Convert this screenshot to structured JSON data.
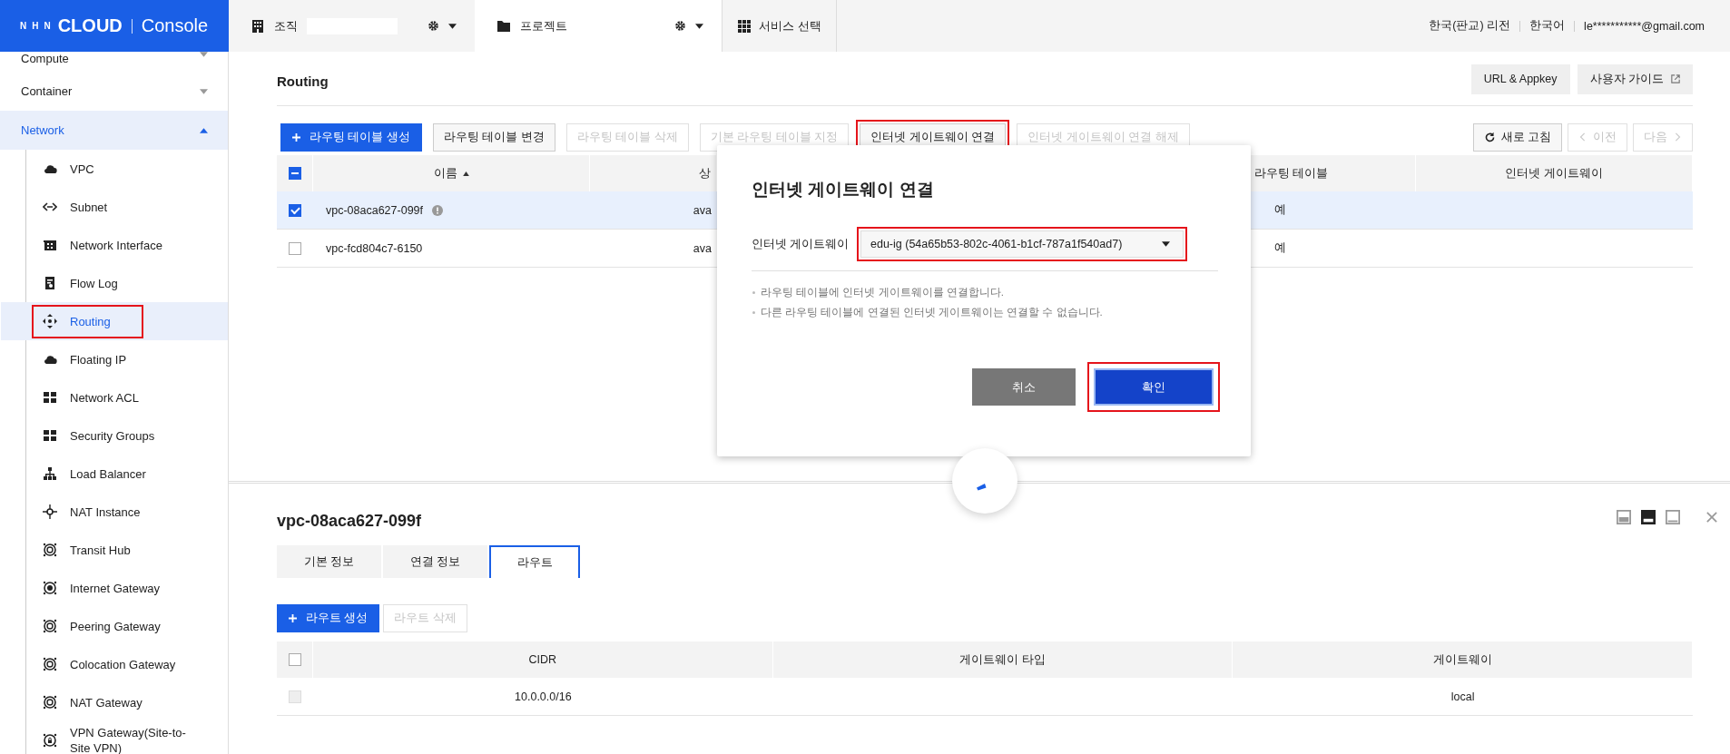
{
  "header": {
    "logo_mark": "NHN",
    "logo_brand": "CLOUD",
    "logo_product": "Console",
    "org_label": "조직",
    "project_label": "프로젝트",
    "service_select": "서비스 선택",
    "region": "한국(판교) 리전",
    "language": "한국어",
    "account": "le***********@gmail.com"
  },
  "sidebar": {
    "groups": [
      {
        "label": "Compute",
        "expanded": false,
        "selected": false
      },
      {
        "label": "Container",
        "expanded": false,
        "selected": false
      },
      {
        "label": "Network",
        "expanded": true,
        "selected": true,
        "children": [
          {
            "label": "VPC",
            "selected": false,
            "highlighted": false
          },
          {
            "label": "Subnet",
            "selected": false,
            "highlighted": false
          },
          {
            "label": "Network Interface",
            "selected": false,
            "highlighted": false
          },
          {
            "label": "Flow Log",
            "selected": false,
            "highlighted": false
          },
          {
            "label": "Routing",
            "selected": true,
            "highlighted": true
          },
          {
            "label": "Floating IP",
            "selected": false,
            "highlighted": false
          },
          {
            "label": "Network ACL",
            "selected": false,
            "highlighted": false
          },
          {
            "label": "Security Groups",
            "selected": false,
            "highlighted": false
          },
          {
            "label": "Load Balancer",
            "selected": false,
            "highlighted": false
          },
          {
            "label": "NAT Instance",
            "selected": false,
            "highlighted": false
          },
          {
            "label": "Transit Hub",
            "selected": false,
            "highlighted": false
          },
          {
            "label": "Internet Gateway",
            "selected": false,
            "highlighted": false
          },
          {
            "label": "Peering Gateway",
            "selected": false,
            "highlighted": false
          },
          {
            "label": "Colocation Gateway",
            "selected": false,
            "highlighted": false
          },
          {
            "label": "NAT Gateway",
            "selected": false,
            "highlighted": false
          },
          {
            "label": "VPN Gateway(Site-to-Site VPN)",
            "selected": false,
            "highlighted": false
          }
        ]
      }
    ]
  },
  "page": {
    "title": "Routing",
    "top_buttons": [
      {
        "label": "URL & Appkey",
        "external": false
      },
      {
        "label": "사용자 가이드",
        "external": true
      }
    ],
    "toolbar": [
      {
        "label": "라우팅 테이블 생성",
        "kind": "primary",
        "disabled": false,
        "highlighted": false
      },
      {
        "label": "라우팅 테이블 변경",
        "kind": "default",
        "disabled": false,
        "highlighted": false
      },
      {
        "label": "라우팅 테이블 삭제",
        "kind": "default",
        "disabled": true,
        "highlighted": false
      },
      {
        "label": "기본 라우팅 테이블 지정",
        "kind": "default",
        "disabled": true,
        "highlighted": false
      },
      {
        "label": "인터넷 게이트웨이 연결",
        "kind": "default",
        "disabled": false,
        "highlighted": true
      },
      {
        "label": "인터넷 게이트웨이 연결 해제",
        "kind": "default",
        "disabled": true,
        "highlighted": false
      }
    ],
    "nav_buttons": [
      {
        "label": "새로 고침",
        "kind": "refresh",
        "disabled": false
      },
      {
        "label": "이전",
        "kind": "prev",
        "disabled": true
      },
      {
        "label": "다음",
        "kind": "next",
        "disabled": true
      }
    ],
    "table": {
      "all_checkbox": {
        "indeterminate": true
      },
      "columns": [
        {
          "label": "이름",
          "sorted": true
        },
        {
          "label": "상",
          "sorted": false
        },
        {
          "label": "라우팅 테이블",
          "sorted": false
        },
        {
          "label": "인터넷 게이트웨이",
          "sorted": false
        }
      ],
      "rows": [
        {
          "selected": true,
          "name": "vpc-08aca627-099f",
          "warning": true,
          "status": "ava",
          "default_table": "예"
        },
        {
          "selected": false,
          "name": "vpc-fcd804c7-6150",
          "warning": false,
          "status": "ava",
          "default_table": "예"
        }
      ]
    }
  },
  "modal": {
    "title": "인터넷 게이트웨이 연결",
    "field_label": "인터넷 게이트웨이",
    "select_value": "edu-ig (54a65b53-802c-4061-b1cf-787a1f540ad7)",
    "select_highlighted": true,
    "notes": [
      "라우팅 테이블에 인터넷 게이트웨이를 연결합니다.",
      "다른 라우팅 테이블에 연결된 인터넷 게이트웨이는 연결할 수 없습니다."
    ],
    "buttons": [
      {
        "label": "취소",
        "kind": "cancel",
        "highlighted": false
      },
      {
        "label": "확인",
        "kind": "confirm",
        "highlighted": true
      }
    ]
  },
  "detail": {
    "title": "vpc-08aca627-099f",
    "layout_modes": [
      {
        "selected": false
      },
      {
        "selected": true
      },
      {
        "selected": false
      }
    ],
    "tabs": [
      {
        "label": "기본 정보",
        "selected": false
      },
      {
        "label": "연결 정보",
        "selected": false
      },
      {
        "label": "라우트",
        "selected": true
      }
    ],
    "buttons": [
      {
        "label": "라우트 생성",
        "kind": "primary",
        "disabled": false
      },
      {
        "label": "라우트 삭제",
        "kind": "default",
        "disabled": true
      }
    ],
    "table": {
      "all_checkbox": {
        "checked": false
      },
      "columns": [
        "CIDR",
        "게이트웨이 타입",
        "게이트웨이"
      ],
      "rows": [
        {
          "checked": false,
          "disabled": true,
          "cidr": "10.0.0.0/16",
          "gateway": "local"
        }
      ]
    }
  }
}
